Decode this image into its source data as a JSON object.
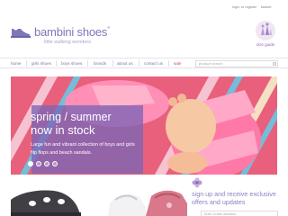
{
  "top_links": {
    "login": "login or register",
    "account": "basket"
  },
  "logo": {
    "name": "bambini shoes",
    "reg": "®",
    "tagline": "little walking wonders"
  },
  "size_guide": {
    "label": "size guide"
  },
  "nav": {
    "items": [
      "home",
      "girls shoes",
      "boys shoes",
      "brands",
      "about us",
      "contact us",
      "sale"
    ],
    "search_placeholder": "product search"
  },
  "hero": {
    "title": "spring / summer",
    "subtitle": "now in stock",
    "description": "Large fun and vibrant collection of boys and girls flip flops and beach sandals.",
    "slides": 4,
    "active_slide": 1
  },
  "signup": {
    "text": "sign up and receive exclusive offers and updates",
    "placeholder": "enter email address"
  },
  "colors": {
    "brand": "#7c78b8",
    "sale": "#d0446e",
    "hero_panel": "#7c65b6"
  }
}
